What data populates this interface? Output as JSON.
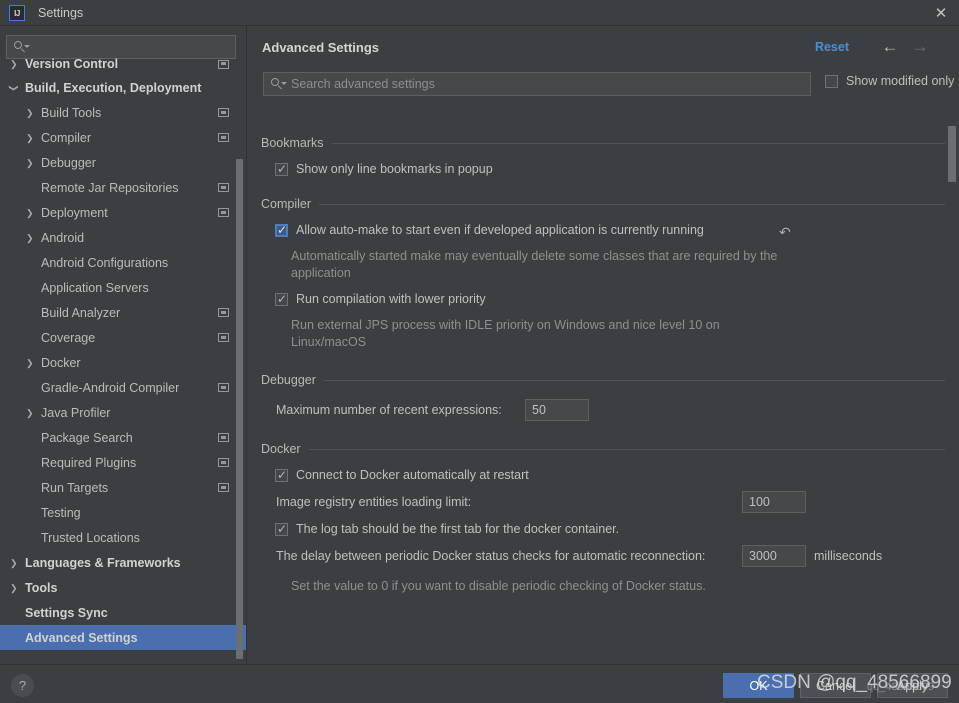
{
  "window": {
    "title": "Settings",
    "logo_icon": "intellij-idea-logo",
    "close_icon": "close-icon"
  },
  "sidebar": {
    "search": {
      "value": "",
      "placeholder": "",
      "icon": "search-dropdown-icon"
    },
    "items": [
      {
        "label": "Version Control",
        "indent": 0,
        "arrow": "collapsed",
        "bold": true,
        "scope_icon": true,
        "selected": false
      },
      {
        "label": "Build, Execution, Deployment",
        "indent": 0,
        "arrow": "expanded",
        "bold": true,
        "scope_icon": false,
        "selected": false
      },
      {
        "label": "Build Tools",
        "indent": 1,
        "arrow": "collapsed",
        "bold": false,
        "scope_icon": true,
        "selected": false
      },
      {
        "label": "Compiler",
        "indent": 1,
        "arrow": "collapsed",
        "bold": false,
        "scope_icon": true,
        "selected": false
      },
      {
        "label": "Debugger",
        "indent": 1,
        "arrow": "collapsed",
        "bold": false,
        "scope_icon": false,
        "selected": false
      },
      {
        "label": "Remote Jar Repositories",
        "indent": 1,
        "arrow": "none",
        "bold": false,
        "scope_icon": true,
        "selected": false
      },
      {
        "label": "Deployment",
        "indent": 1,
        "arrow": "collapsed",
        "bold": false,
        "scope_icon": true,
        "selected": false
      },
      {
        "label": "Android",
        "indent": 1,
        "arrow": "collapsed",
        "bold": false,
        "scope_icon": false,
        "selected": false
      },
      {
        "label": "Android Configurations",
        "indent": 1,
        "arrow": "none",
        "bold": false,
        "scope_icon": false,
        "selected": false
      },
      {
        "label": "Application Servers",
        "indent": 1,
        "arrow": "none",
        "bold": false,
        "scope_icon": false,
        "selected": false
      },
      {
        "label": "Build Analyzer",
        "indent": 1,
        "arrow": "none",
        "bold": false,
        "scope_icon": true,
        "selected": false
      },
      {
        "label": "Coverage",
        "indent": 1,
        "arrow": "none",
        "bold": false,
        "scope_icon": true,
        "selected": false
      },
      {
        "label": "Docker",
        "indent": 1,
        "arrow": "collapsed",
        "bold": false,
        "scope_icon": false,
        "selected": false
      },
      {
        "label": "Gradle-Android Compiler",
        "indent": 1,
        "arrow": "none",
        "bold": false,
        "scope_icon": true,
        "selected": false
      },
      {
        "label": "Java Profiler",
        "indent": 1,
        "arrow": "collapsed",
        "bold": false,
        "scope_icon": false,
        "selected": false
      },
      {
        "label": "Package Search",
        "indent": 1,
        "arrow": "none",
        "bold": false,
        "scope_icon": true,
        "selected": false
      },
      {
        "label": "Required Plugins",
        "indent": 1,
        "arrow": "none",
        "bold": false,
        "scope_icon": true,
        "selected": false
      },
      {
        "label": "Run Targets",
        "indent": 1,
        "arrow": "none",
        "bold": false,
        "scope_icon": true,
        "selected": false
      },
      {
        "label": "Testing",
        "indent": 1,
        "arrow": "none",
        "bold": false,
        "scope_icon": false,
        "selected": false
      },
      {
        "label": "Trusted Locations",
        "indent": 1,
        "arrow": "none",
        "bold": false,
        "scope_icon": false,
        "selected": false
      },
      {
        "label": "Languages & Frameworks",
        "indent": 0,
        "arrow": "collapsed",
        "bold": true,
        "scope_icon": false,
        "selected": false
      },
      {
        "label": "Tools",
        "indent": 0,
        "arrow": "collapsed",
        "bold": true,
        "scope_icon": false,
        "selected": false
      },
      {
        "label": "Settings Sync",
        "indent": 0,
        "arrow": "none",
        "bold": true,
        "scope_icon": false,
        "selected": false
      },
      {
        "label": "Advanced Settings",
        "indent": 0,
        "arrow": "none",
        "bold": true,
        "scope_icon": false,
        "selected": true
      }
    ]
  },
  "main": {
    "title": "Advanced Settings",
    "reset_label": "Reset",
    "nav_back_icon": "arrow-left-icon",
    "nav_forward_icon": "arrow-right-icon",
    "search": {
      "value": "",
      "placeholder": "Search advanced settings",
      "icon": "search-icon"
    },
    "show_modified_only": {
      "label": "Show modified only",
      "checked": false
    },
    "sections": [
      {
        "name": "Bookmarks",
        "rows": [
          {
            "kind": "checkbox",
            "label": "Show only line bookmarks in popup",
            "checked": true,
            "modified": false
          }
        ]
      },
      {
        "name": "Compiler",
        "rows": [
          {
            "kind": "checkbox",
            "label": "Allow auto-make to start even if developed application is currently running",
            "checked": true,
            "modified": true,
            "rollback_icon": "rollback-icon"
          },
          {
            "kind": "description",
            "text": "Automatically started make may eventually delete some classes that are required by the application"
          },
          {
            "kind": "checkbox",
            "label": "Run compilation with lower priority",
            "checked": true,
            "modified": false
          },
          {
            "kind": "description",
            "text": "Run external JPS process with IDLE priority on Windows and nice level 10 on Linux/macOS"
          }
        ]
      },
      {
        "name": "Debugger",
        "rows": [
          {
            "kind": "field",
            "label": "Maximum number of recent expressions:",
            "value": "50"
          }
        ]
      },
      {
        "name": "Docker",
        "rows": [
          {
            "kind": "checkbox",
            "label": "Connect to Docker automatically at restart",
            "checked": true,
            "modified": false
          },
          {
            "kind": "field",
            "label": "Image registry entities loading limit:",
            "value": "100"
          },
          {
            "kind": "checkbox",
            "label": "The log tab should be the first tab for the docker container.",
            "checked": true,
            "modified": false
          },
          {
            "kind": "field",
            "label": "The delay between periodic Docker status checks for automatic reconnection:",
            "value": "3000",
            "unit": "milliseconds"
          },
          {
            "kind": "description",
            "text": "Set the value to 0 if you want to disable periodic checking of Docker status."
          }
        ]
      }
    ]
  },
  "footer": {
    "help_label": "?",
    "ok_label": "OK",
    "cancel_label": "Cancel",
    "apply_label": "Apply"
  },
  "overlay": {
    "watermark": "CSDN @qq_48566899",
    "watermark_small": "qq_48566899"
  },
  "colors": {
    "background": "#3c3f41",
    "selection": "#4b6eaf",
    "accent_link": "#4b8ed8",
    "text": "#bdc0c1",
    "text_dim": "#8c9091",
    "field_bg": "#45494a",
    "border": "#5e6060"
  }
}
